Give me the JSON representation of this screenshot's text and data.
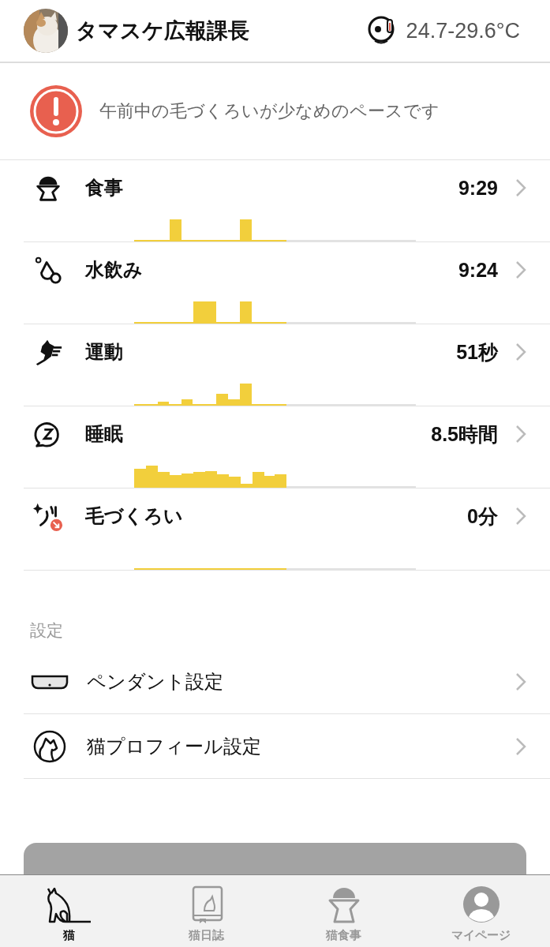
{
  "header": {
    "cat_name": "タマスケ広報課長",
    "temperature": "24.7-29.6°C"
  },
  "alert": {
    "message": "午前中の毛づくろいが少なめのペースです"
  },
  "activities": [
    {
      "kind": "meal",
      "label": "食事",
      "value": "9:29"
    },
    {
      "kind": "water",
      "label": "水飲み",
      "value": "9:24"
    },
    {
      "kind": "exercise",
      "label": "運動",
      "value": "51秒"
    },
    {
      "kind": "sleep",
      "label": "睡眠",
      "value": "8.5時間"
    },
    {
      "kind": "grooming",
      "label": "毛づくろい",
      "value": "0分",
      "warning": true
    }
  ],
  "settings": {
    "heading": "設定",
    "items": [
      {
        "kind": "pendant",
        "label": "ペンダント設定"
      },
      {
        "kind": "profile",
        "label": "猫プロフィール設定"
      }
    ]
  },
  "tabs": [
    {
      "kind": "cat",
      "label": "猫",
      "selected": true
    },
    {
      "kind": "diary",
      "label": "猫日誌",
      "selected": false
    },
    {
      "kind": "meal",
      "label": "猫食事",
      "selected": false
    },
    {
      "kind": "mypage",
      "label": "マイページ",
      "selected": false
    }
  ]
}
